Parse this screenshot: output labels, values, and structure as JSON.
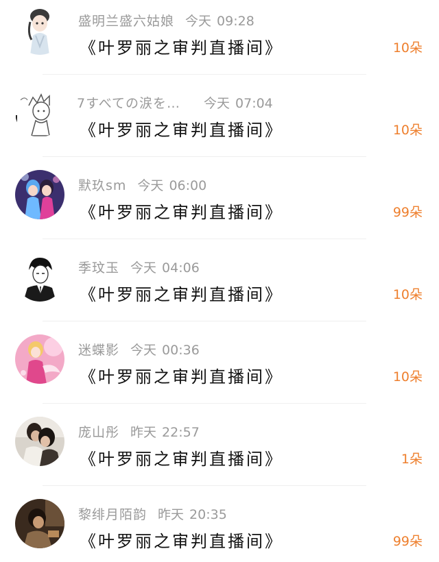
{
  "gift_list": {
    "items": [
      {
        "name": "盛明兰盛六姑娘",
        "day": "今天",
        "time": "09:28",
        "room": "《叶罗丽之审判直播间》",
        "count": "10朵"
      },
      {
        "name": "7すべての涙を…",
        "day": "今天",
        "time": "07:04",
        "room": "《叶罗丽之审判直播间》",
        "count": "10朵"
      },
      {
        "name": "默玖sm",
        "day": "今天",
        "time": "06:00",
        "room": "《叶罗丽之审判直播间》",
        "count": "99朵"
      },
      {
        "name": "季玟玉",
        "day": "今天",
        "time": "04:06",
        "room": "《叶罗丽之审判直播间》",
        "count": "10朵"
      },
      {
        "name": "迷蝶影",
        "day": "今天",
        "time": "00:36",
        "room": "《叶罗丽之审判直播间》",
        "count": "10朵"
      },
      {
        "name": "庞山彤",
        "day": "昨天",
        "time": "22:57",
        "room": "《叶罗丽之审判直播间》",
        "count": "1朵"
      },
      {
        "name": "黎绯月陌韵",
        "day": "昨天",
        "time": "20:35",
        "room": "《叶罗丽之审判直播间》",
        "count": "99朵"
      }
    ]
  },
  "colors": {
    "count_accent": "#ee7f2d",
    "meta_gray": "#9a9a9a",
    "title_black": "#111111"
  }
}
